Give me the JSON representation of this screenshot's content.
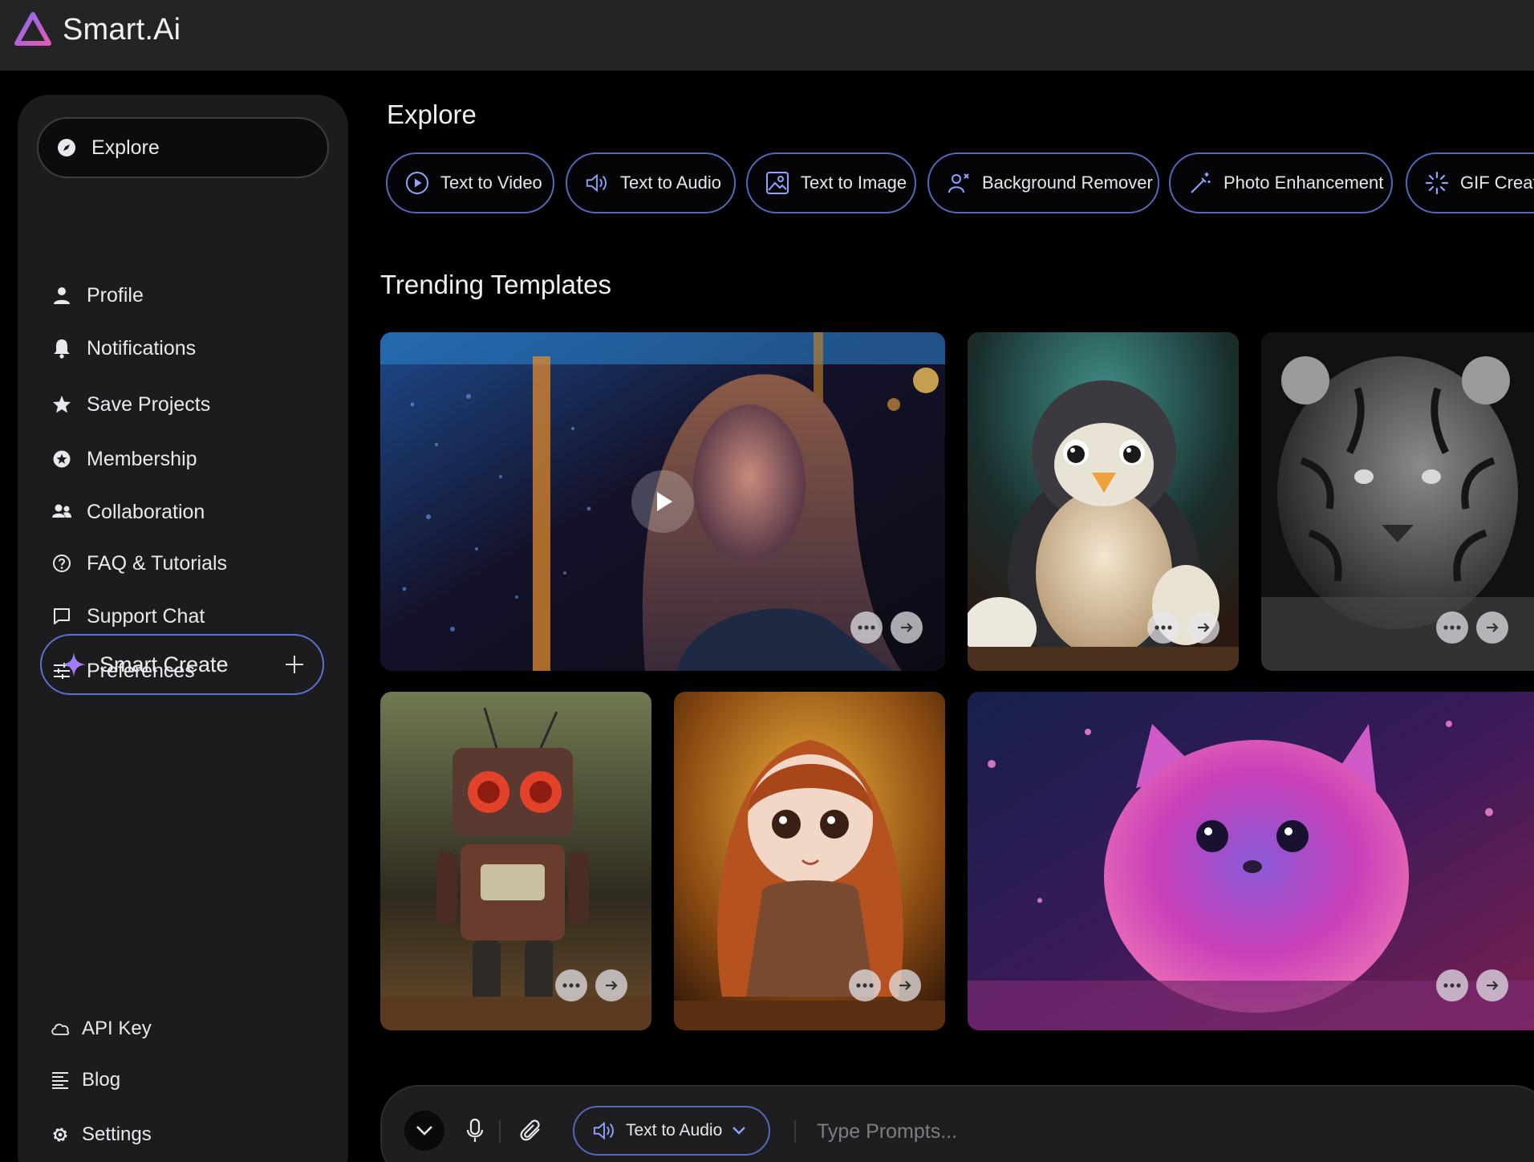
{
  "app": {
    "name": "Smart.Ai",
    "accent": "#6f7fe0",
    "logo_gradient": [
      "#7b6cf6",
      "#e05ab0"
    ]
  },
  "sidebar": {
    "items": [
      {
        "label": "Explore",
        "icon": "compass-icon",
        "active": true
      },
      {
        "label": "Profile",
        "icon": "user-icon"
      },
      {
        "label": "Notifications",
        "icon": "bell-icon"
      },
      {
        "label": "Save Projects",
        "icon": "star-icon"
      },
      {
        "label": "Membership",
        "icon": "badge-icon"
      },
      {
        "label": "Collaboration",
        "icon": "users-icon"
      },
      {
        "label": "FAQ & Tutorials",
        "icon": "help-circle-icon"
      },
      {
        "label": "Support Chat",
        "icon": "chat-bubble-icon"
      },
      {
        "label": "Preferences",
        "icon": "sliders-icon"
      }
    ],
    "smart_create_label": "Smart Create",
    "bottom_items": [
      {
        "label": "API Key",
        "icon": "cloud-icon"
      },
      {
        "label": "Blog",
        "icon": "lines-icon"
      },
      {
        "label": "Settings",
        "icon": "gear-icon"
      }
    ]
  },
  "main": {
    "title": "Explore",
    "tools": [
      {
        "label": "Text to Video",
        "icon": "play-circle-icon"
      },
      {
        "label": "Text to Audio",
        "icon": "speaker-icon"
      },
      {
        "label": "Text to Image",
        "icon": "image-icon"
      },
      {
        "label": "Background Remover",
        "icon": "user-remove-icon"
      },
      {
        "label": "Photo Enhancement",
        "icon": "magic-wand-icon"
      },
      {
        "label": "GIF Creator",
        "icon": "loader-icon"
      }
    ],
    "trending_title": "Trending Templates",
    "templates": [
      {
        "subject": "woman-in-rain",
        "type": "video"
      },
      {
        "subject": "penguin-with-eggs",
        "type": "image"
      },
      {
        "subject": "tiger-black-and-white",
        "type": "image"
      },
      {
        "subject": "rusty-robot",
        "type": "image"
      },
      {
        "subject": "doll-girl",
        "type": "image"
      },
      {
        "subject": "pink-fluffy-creature",
        "type": "image"
      }
    ]
  },
  "composer": {
    "mode_label": "Text to Audio",
    "placeholder": "Type Prompts..."
  }
}
